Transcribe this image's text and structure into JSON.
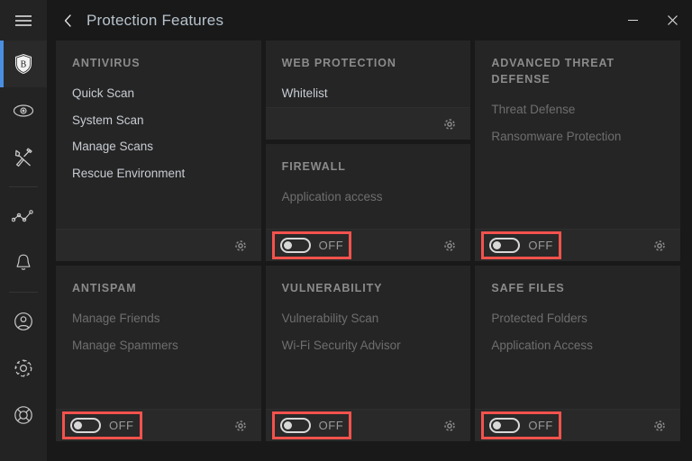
{
  "window": {
    "title": "Protection Features",
    "back_icon": "chevron-left-icon",
    "minimize_label": "Minimize",
    "close_label": "Close"
  },
  "sidebar": {
    "menu_icon": "hamburger-menu-icon",
    "items": [
      {
        "icon": "shield-b-logo-icon",
        "label": "Protection",
        "active": true
      },
      {
        "icon": "eye-icon",
        "label": "Privacy",
        "active": false
      },
      {
        "icon": "tools-icon",
        "label": "Utilities",
        "active": false
      },
      {
        "icon": "activity-chart-icon",
        "label": "Activity",
        "active": false
      },
      {
        "icon": "bell-icon",
        "label": "Notifications",
        "active": false
      },
      {
        "icon": "user-circle-icon",
        "label": "Account",
        "active": false
      },
      {
        "icon": "gear-icon",
        "label": "Settings",
        "active": false
      },
      {
        "icon": "lifebuoy-icon",
        "label": "Support",
        "active": false
      }
    ]
  },
  "cards": {
    "antivirus": {
      "title": "ANTIVIRUS",
      "links": [
        {
          "label": "Quick Scan",
          "disabled": false
        },
        {
          "label": "System Scan",
          "disabled": false
        },
        {
          "label": "Manage Scans",
          "disabled": false
        },
        {
          "label": "Rescue Environment",
          "disabled": false
        }
      ],
      "has_toggle": false,
      "gear_icon": "gear-icon"
    },
    "web_protection": {
      "title": "WEB PROTECTION",
      "links": [
        {
          "label": "Whitelist",
          "disabled": false
        }
      ],
      "has_toggle": false,
      "gear_icon": "gear-icon"
    },
    "firewall": {
      "title": "FIREWALL",
      "links": [
        {
          "label": "Application access",
          "disabled": true
        }
      ],
      "has_toggle": true,
      "toggle_state": "OFF",
      "toggle_highlighted": true,
      "gear_icon": "gear-icon"
    },
    "advanced_threat_defense": {
      "title": "ADVANCED THREAT DEFENSE",
      "links": [
        {
          "label": "Threat Defense",
          "disabled": true
        },
        {
          "label": "Ransomware Protection",
          "disabled": true
        }
      ],
      "has_toggle": true,
      "toggle_state": "OFF",
      "toggle_highlighted": true,
      "gear_icon": "gear-icon"
    },
    "antispam": {
      "title": "ANTISPAM",
      "links": [
        {
          "label": "Manage Friends",
          "disabled": true
        },
        {
          "label": "Manage Spammers",
          "disabled": true
        }
      ],
      "has_toggle": true,
      "toggle_state": "OFF",
      "toggle_highlighted": true,
      "gear_icon": "gear-icon"
    },
    "vulnerability": {
      "title": "VULNERABILITY",
      "links": [
        {
          "label": "Vulnerability Scan",
          "disabled": true
        },
        {
          "label": "Wi-Fi Security Advisor",
          "disabled": true
        }
      ],
      "has_toggle": true,
      "toggle_state": "OFF",
      "toggle_highlighted": true,
      "gear_icon": "gear-icon"
    },
    "safe_files": {
      "title": "SAFE FILES",
      "links": [
        {
          "label": "Protected Folders",
          "disabled": true
        },
        {
          "label": "Application Access",
          "disabled": true
        }
      ],
      "has_toggle": true,
      "toggle_state": "OFF",
      "toggle_highlighted": true,
      "gear_icon": "gear-icon"
    }
  },
  "colors": {
    "window_bg": "#191919",
    "sidebar_bg": "#232323",
    "card_bg": "#252525",
    "card_footer_bg": "#292929",
    "accent_blue": "#4a8fe0",
    "highlight_red": "#f4524d",
    "title_text": "#b7c2cc",
    "heading_text": "#8b8b8b",
    "link_text": "#c7ccd2",
    "link_disabled_text": "#6e6e6e"
  }
}
